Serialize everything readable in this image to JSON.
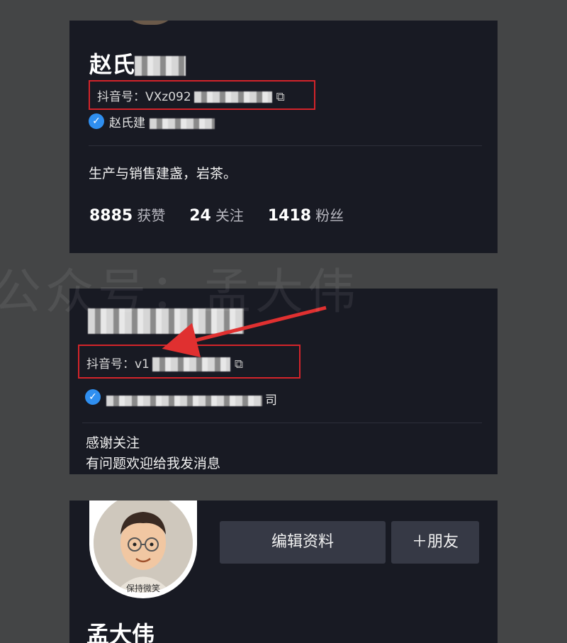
{
  "profile1": {
    "name": "赵氏",
    "douyin_id": "抖音号：VXz092",
    "verified_text": "赵氏建",
    "bio": "生产与销售建盏，岩茶。",
    "stats": [
      {
        "num": "8885",
        "label": "获赞"
      },
      {
        "num": "24",
        "label": "关注"
      },
      {
        "num": "1418",
        "label": "粉丝"
      }
    ]
  },
  "watermark": "公众号：孟大伟",
  "profile2": {
    "douyin_id": "抖音号：v1",
    "verified_text": "司",
    "bio_line1": "感谢关注",
    "bio_line2": "有问题欢迎给我发消息"
  },
  "profile3": {
    "avatar_caption": "保持微笑",
    "edit_button": "编辑资料",
    "add_friend_button": "＋朋友",
    "name": "孟大伟"
  },
  "colors": {
    "highlight_box": "#d3242a",
    "verified_badge": "#2f8ff0",
    "card_bg": "#181a23"
  }
}
